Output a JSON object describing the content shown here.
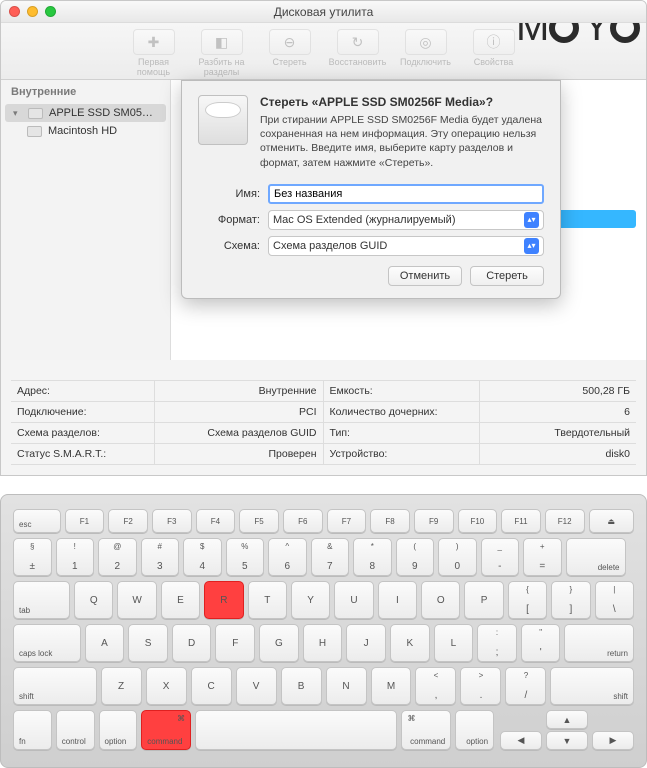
{
  "watermark": "M O Y O",
  "window": {
    "title": "Дисковая утилита",
    "toolbar": [
      {
        "label": "Первая помощь",
        "icon": "✚"
      },
      {
        "label": "Разбить на разделы",
        "icon": "◧"
      },
      {
        "label": "Стереть",
        "icon": "⊖"
      },
      {
        "label": "Восстановить",
        "icon": "↻"
      },
      {
        "label": "Подключить",
        "icon": "◎"
      },
      {
        "label": "Свойства",
        "icon": "ⓘ"
      }
    ],
    "sidebar": {
      "header": "Внутренние",
      "items": [
        {
          "label": "APPLE SSD SM05…",
          "selected": true
        },
        {
          "label": "Macintosh HD",
          "selected": false
        }
      ]
    },
    "info": [
      {
        "l": "Адрес:",
        "v": "Внутренние",
        "l2": "Емкость:",
        "v2": "500,28 ГБ"
      },
      {
        "l": "Подключение:",
        "v": "PCI",
        "l2": "Количество дочерних:",
        "v2": "6"
      },
      {
        "l": "Схема разделов:",
        "v": "Схема разделов GUID",
        "l2": "Тип:",
        "v2": "Твердотельный"
      },
      {
        "l": "Статус S.M.A.R.T.:",
        "v": "Проверен",
        "l2": "Устройство:",
        "v2": "disk0"
      }
    ]
  },
  "dialog": {
    "title": "Стереть «APPLE SSD SM0256F Media»?",
    "description": "При стирании APPLE SSD SM0256F Media будет удалена сохраненная на нем информация. Эту операцию нельзя отменить. Введите имя, выберите карту разделов и формат, затем нажмите «Стереть».",
    "name_label": "Имя:",
    "name_value": "Без названия",
    "format_label": "Формат:",
    "format_value": "Mac OS Extended (журналируемый)",
    "scheme_label": "Схема:",
    "scheme_value": "Схема разделов GUID",
    "cancel": "Отменить",
    "erase": "Стереть"
  },
  "keyboard": {
    "row0": [
      "esc",
      "F1",
      "F2",
      "F3",
      "F4",
      "F5",
      "F6",
      "F7",
      "F8",
      "F9",
      "F10",
      "F11",
      "F12",
      "⏏"
    ],
    "row1": [
      {
        "t": "§",
        "b": "±"
      },
      {
        "t": "!",
        "b": "1"
      },
      {
        "t": "@",
        "b": "2"
      },
      {
        "t": "#",
        "b": "3"
      },
      {
        "t": "$",
        "b": "4"
      },
      {
        "t": "%",
        "b": "5"
      },
      {
        "t": "^",
        "b": "6"
      },
      {
        "t": "&",
        "b": "7"
      },
      {
        "t": "*",
        "b": "8"
      },
      {
        "t": "(",
        "b": "9"
      },
      {
        "t": ")",
        "b": "0"
      },
      {
        "t": "_",
        "b": "-"
      },
      {
        "t": "+",
        "b": "="
      },
      {
        "del": "delete"
      }
    ],
    "row2": [
      "tab",
      "Q",
      "W",
      "E",
      "R",
      "T",
      "Y",
      "U",
      "I",
      "O",
      "P",
      {
        "t": "{",
        "b": "["
      },
      {
        "t": "}",
        "b": "]"
      },
      {
        "t": "|",
        "b": "\\"
      }
    ],
    "row3": [
      "caps lock",
      "A",
      "S",
      "D",
      "F",
      "G",
      "H",
      "J",
      "K",
      "L",
      {
        "t": ":",
        "b": ";"
      },
      {
        "t": "\"",
        "b": "'"
      },
      "return"
    ],
    "row4": [
      "shift",
      "Z",
      "X",
      "C",
      "V",
      "B",
      "N",
      "M",
      {
        "t": "<",
        "b": ","
      },
      {
        "t": ">",
        "b": "."
      },
      {
        "t": "?",
        "b": "/"
      },
      "shift"
    ],
    "row5": {
      "fn": "fn",
      "ctrl": "control",
      "opt": "option",
      "cmd": "command",
      "space": "",
      "cmd2": "command",
      "opt2": "option"
    },
    "arrows": {
      "up": "▲",
      "left": "◀",
      "down": "▼",
      "right": "▶"
    },
    "highlighted": [
      "R",
      "command-left"
    ]
  }
}
